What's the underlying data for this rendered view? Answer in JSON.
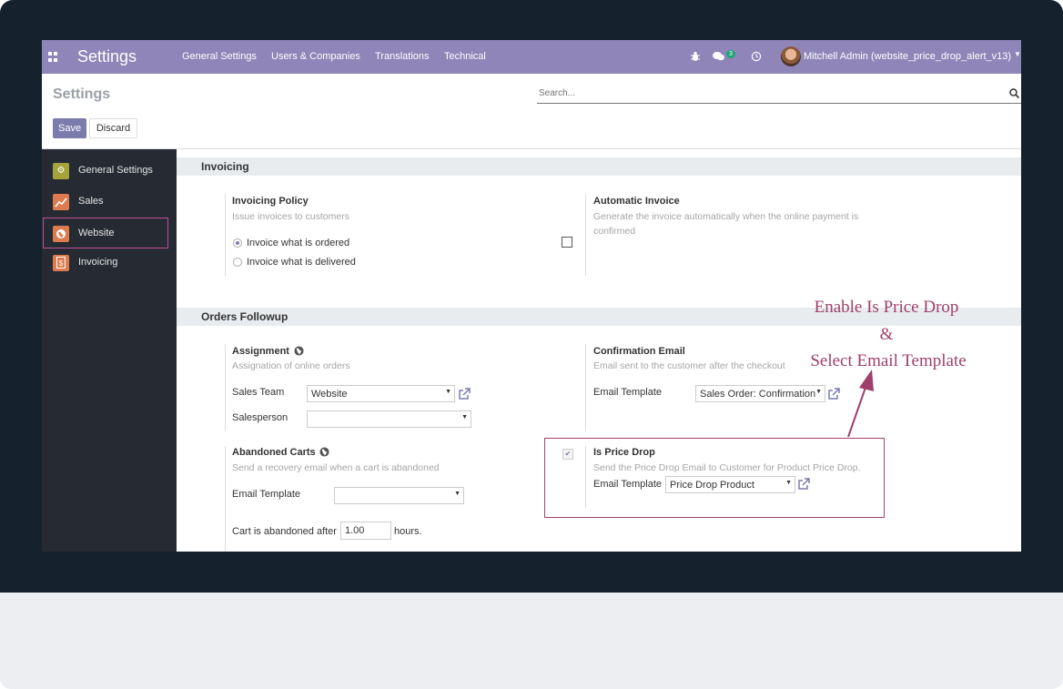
{
  "navbar": {
    "app_title": "Settings",
    "menu": [
      "General Settings",
      "Users & Companies",
      "Translations",
      "Technical"
    ],
    "messages_count": "3",
    "user": "Mitchell Admin (website_price_drop_alert_v13)"
  },
  "control_panel": {
    "title": "Settings",
    "search_placeholder": "Search...",
    "save_label": "Save",
    "discard_label": "Discard"
  },
  "sidebar": {
    "items": [
      {
        "label": "General Settings",
        "icon": "gear-icon",
        "color": "#a5a33b"
      },
      {
        "label": "Sales",
        "icon": "chart-icon",
        "color": "#dd7b4f"
      },
      {
        "label": "Website",
        "icon": "globe-icon",
        "color": "#dd7b4f",
        "active": true
      },
      {
        "label": "Invoicing",
        "icon": "invoice-icon",
        "color": "#dd7b4f"
      }
    ]
  },
  "invoicing": {
    "heading": "Invoicing",
    "policy_label": "Invoicing Policy",
    "policy_help": "Issue invoices to customers",
    "options": [
      "Invoice what is ordered",
      "Invoice what is delivered"
    ],
    "selected_option": 0,
    "auto_label": "Automatic Invoice",
    "auto_help": "Generate the invoice automatically when the online payment is confirmed",
    "auto_checked": false
  },
  "orders": {
    "heading": "Orders Followup",
    "assignment_label": "Assignment",
    "assignment_help": "Assignation of online orders",
    "sales_team_label": "Sales Team",
    "sales_team_value": "Website",
    "salesperson_label": "Salesperson",
    "salesperson_value": "",
    "confirm_label": "Confirmation Email",
    "confirm_help": "Email sent to the customer after the checkout",
    "confirm_template_label": "Email Template",
    "confirm_template_value": "Sales Order: Confirmation",
    "abandoned_label": "Abandoned Carts",
    "abandoned_help": "Send a recovery email when a cart is abandoned",
    "abandoned_template_label": "Email Template",
    "abandoned_template_value": "",
    "cart_after_label": "Cart is abandoned after",
    "cart_after_value": "1.00",
    "cart_after_unit": "hours.",
    "pricedrop_label": "Is Price Drop",
    "pricedrop_help": "Send the Price Drop Email to Customer for Product Price Drop.",
    "pricedrop_checked": true,
    "pricedrop_template_label": "Email Template",
    "pricedrop_template_value": "Price Drop Product"
  },
  "annotation": {
    "line1": "Enable Is Price Drop",
    "line2": "&",
    "line3": "Select Email Template",
    "color": "#9e3f6c"
  }
}
